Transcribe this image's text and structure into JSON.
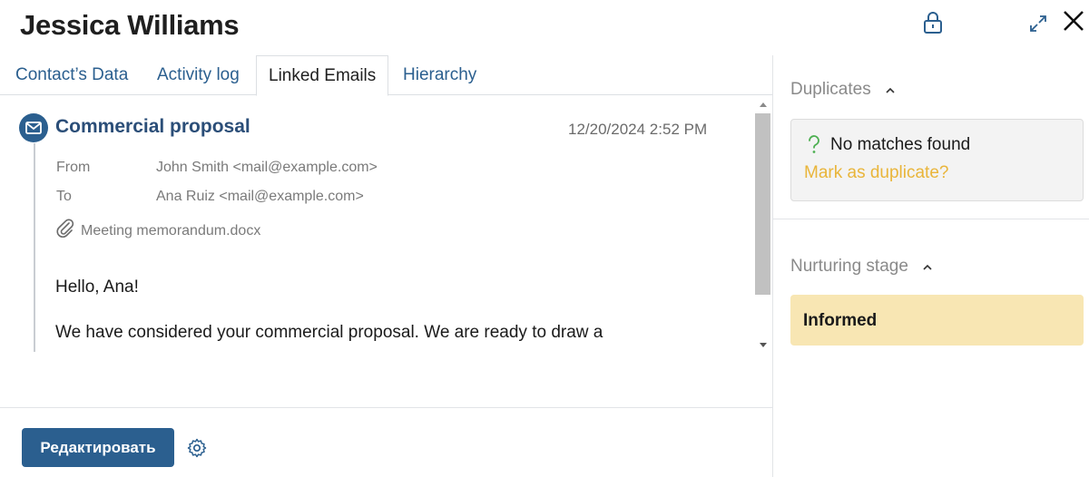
{
  "header": {
    "title": "Jessica Williams",
    "icons": [
      "lock-icon",
      "expand-icon",
      "close-icon"
    ]
  },
  "tabs": [
    {
      "label": "Contact’s Data",
      "active": false
    },
    {
      "label": "Activity log",
      "active": false
    },
    {
      "label": "Linked Emails",
      "active": true
    },
    {
      "label": "Hierarchy",
      "active": false
    }
  ],
  "email": {
    "subject": "Commercial proposal",
    "date": "12/20/2024 2:52 PM",
    "from_label": "From",
    "from_value": "John Smith <mail@example.com>",
    "to_label": "To",
    "to_value": "Ana Ruiz <mail@example.com>",
    "attachment": "Meeting memorandum.docx",
    "body": [
      "Hello, Ana!",
      "We have considered your commercial proposal. We are ready to draw a"
    ]
  },
  "footer": {
    "edit_label": "Редактировать"
  },
  "duplicates": {
    "title": "Duplicates",
    "status": "No matches found",
    "action": "Mark as duplicate?"
  },
  "nurturing": {
    "title": "Nurturing stage",
    "value": "Informed"
  },
  "colors": {
    "accent": "#2b5f8f",
    "link": "#e9b53a",
    "stage_bg": "#f8e6b3"
  }
}
